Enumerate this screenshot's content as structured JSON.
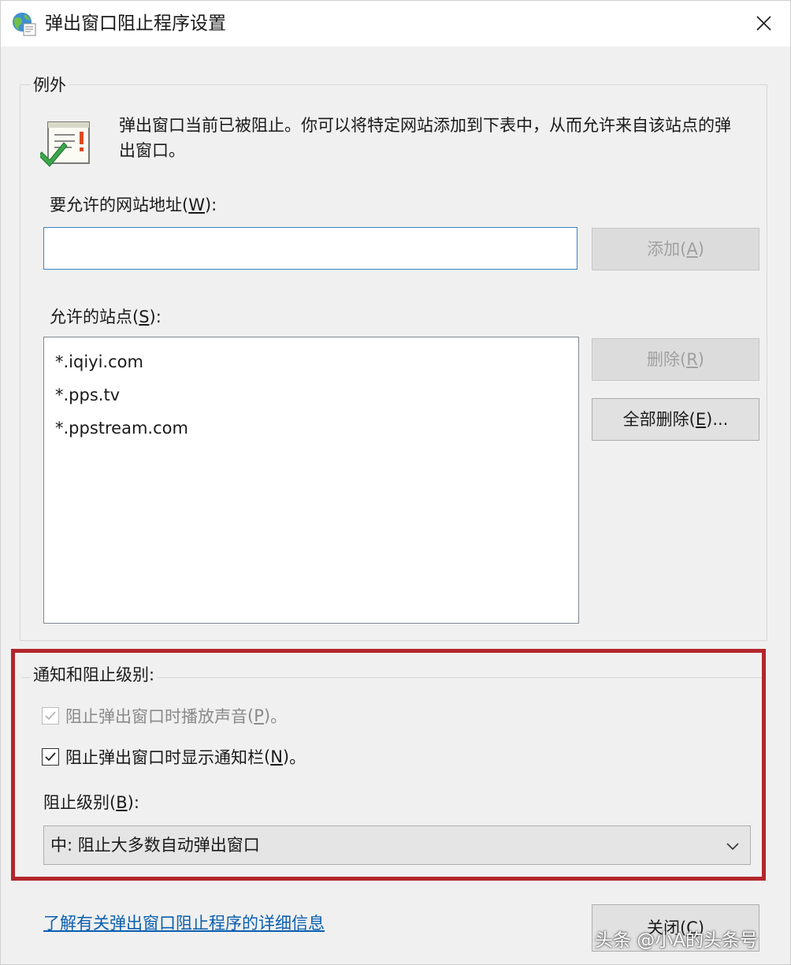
{
  "window": {
    "title": "弹出窗口阻止程序设置",
    "app_icon": "ie-globe-icon",
    "close_icon": "close-icon"
  },
  "exceptions": {
    "legend": "例外",
    "info_icon": "notepad-check-icon",
    "info_text": "弹出窗口当前已被阻止。你可以将特定网站添加到下表中，从而允许来自该站点的弹出窗口。",
    "address_label": "要允许的网站地址",
    "address_accel": "W",
    "address_value": "",
    "add_button": {
      "label": "添加",
      "accel": "A"
    },
    "sites_label": "允许的站点",
    "sites_accel": "S",
    "sites": [
      "*.iqiyi.com",
      "*.pps.tv",
      "*.ppstream.com"
    ],
    "remove_button": {
      "label": "删除",
      "accel": "R"
    },
    "remove_all_button": {
      "label": "全部删除",
      "accel": "E",
      "suffix": "..."
    }
  },
  "notify": {
    "legend": "通知和阻止级别:",
    "play_sound": {
      "label": "阻止弹出窗口时播放声音",
      "accel": "P",
      "suffix": "。",
      "checked": true,
      "enabled": false
    },
    "show_bar": {
      "label": "阻止弹出窗口时显示通知栏",
      "accel": "N",
      "suffix": "。",
      "checked": true,
      "enabled": true
    },
    "level_label": "阻止级别",
    "level_accel": "B",
    "level_value": "中: 阻止大多数自动弹出窗口"
  },
  "footer": {
    "help_link": "了解有关弹出窗口阻止程序的详细信息",
    "close_button": {
      "label": "关闭",
      "accel": "C"
    },
    "watermark": "头条 @小A的头条号"
  },
  "colors": {
    "highlight": "#b3262b",
    "link": "#0b5fb0",
    "input_border": "#3c84c6"
  }
}
